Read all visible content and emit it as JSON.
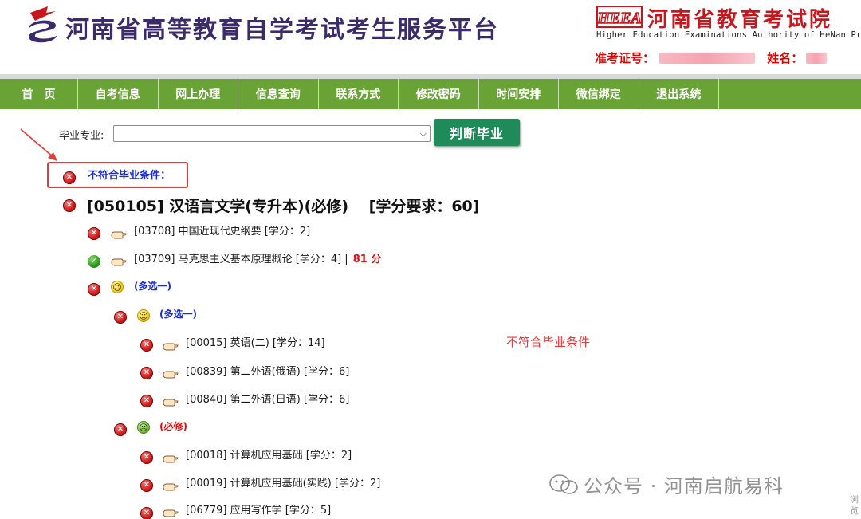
{
  "header": {
    "site_title": "河南省高等教育自学考试考生服务平台",
    "heea_logo_text": "HEEA",
    "heea_name": "河南省教育考试院",
    "heea_en": "Higher Education Examinations Authority of HeNan Province",
    "ticket_label": "准考证号：",
    "name_label": "姓名："
  },
  "nav": {
    "items": [
      "首　页",
      "自考信息",
      "网上办理",
      "信息查询",
      "联系方式",
      "修改密码",
      "时间安排",
      "微信绑定",
      "退出系统"
    ]
  },
  "form": {
    "major_label": "毕业专业:",
    "major_value": "",
    "judge_button": "判断毕业"
  },
  "result": {
    "status_title": "不符合毕业条件：",
    "major_title": "[050105] 汉语言文学(专升本)(必修)　 [学分要求：60]",
    "courses": [
      {
        "text": "[03708] 中国近现代史纲要 [学分：2]",
        "score": ""
      },
      {
        "text": "[03709] 马克思主义基本原理概论 [学分：4] |",
        "score": "81 分"
      }
    ],
    "group_level1": "(多选一)",
    "group_level2_a": "(多选一)",
    "sub_courses_a": [
      "[00015] 英语(二) [学分：14]",
      "[00839] 第二外语(俄语) [学分：6]",
      "[00840] 第二外语(日语) [学分：6]"
    ],
    "group_level2_b": "(必修)",
    "sub_courses_b": [
      "[00018] 计算机应用基础 [学分：2]",
      "[00019] 计算机应用基础(实践) [学分：2]",
      "[06779] 应用写作学 [学分：5]"
    ],
    "annotation": "不符合毕业条件"
  },
  "watermark": {
    "text": "公众号 · 河南启航易科",
    "corner": "浏览"
  },
  "colors": {
    "nav_green": "#6aa335",
    "button_green": "#1f8a5a",
    "title_purple": "#3c2b6b",
    "heea_red": "#c8161d",
    "link_blue": "#1a2cd4",
    "alert_red": "#e01010"
  }
}
